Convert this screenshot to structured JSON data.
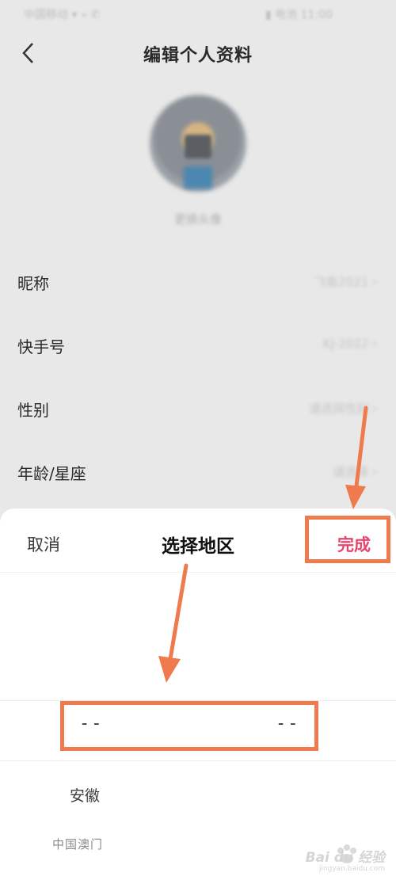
{
  "status_bar": {
    "left": "中国移动 ▾ ⌁ ✆",
    "right": "▮ 电池 11:00"
  },
  "header": {
    "title": "编辑个人资料"
  },
  "profile": {
    "avatar_caption": "更换头像",
    "rows": [
      {
        "label": "昵称",
        "value": "飞鱼2021 ›"
      },
      {
        "label": "快手号",
        "value": "KJ-2022 ›"
      },
      {
        "label": "性别",
        "value": "请选择性别 ›"
      },
      {
        "label": "年龄/星座",
        "value": "请选择 ›"
      }
    ]
  },
  "region_sheet": {
    "cancel_label": "取消",
    "title": "选择地区",
    "done_label": "完成",
    "selected_left": "--",
    "selected_right": "--",
    "options": [
      "安徽",
      "中国澳门"
    ]
  },
  "watermark": {
    "text": "Bai du 经验",
    "url": "jingyan.baidu.com"
  },
  "colors": {
    "accent": "#e8456c",
    "annotation": "#ef7a4e"
  }
}
